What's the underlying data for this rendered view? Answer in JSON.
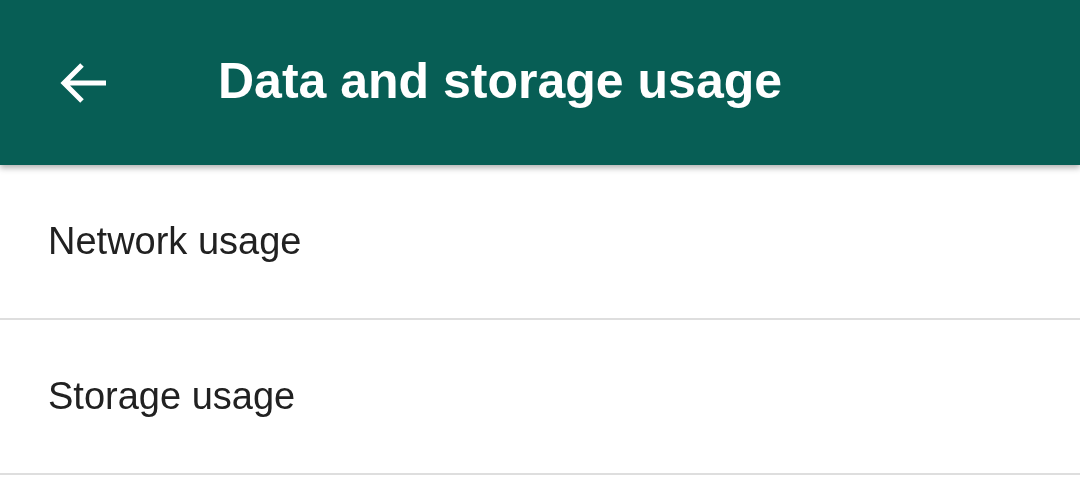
{
  "app_bar": {
    "title": "Data and storage usage"
  },
  "items": [
    {
      "label": "Network usage"
    },
    {
      "label": "Storage usage"
    }
  ]
}
